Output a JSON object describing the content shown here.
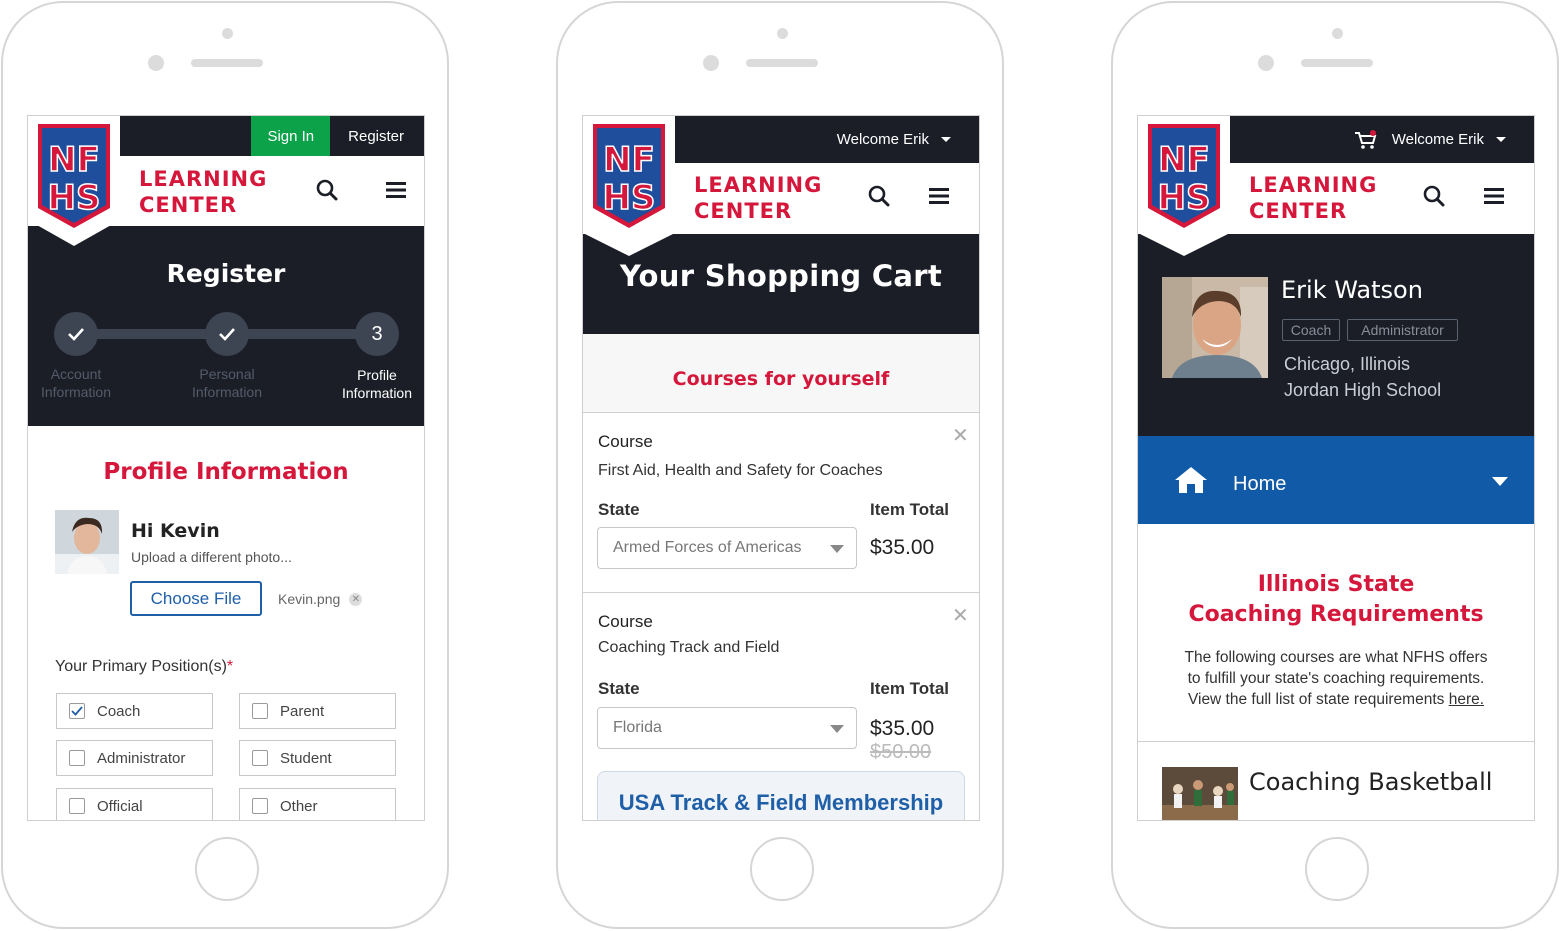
{
  "brand": {
    "logo_letters_top": "NF",
    "logo_letters_bottom": "HS",
    "line1": "LEARNING",
    "line2": "CENTER",
    "red": "#d4173a",
    "navy": "#1b1e27",
    "blue": "#105aa8",
    "green": "#0ba24a"
  },
  "screen1": {
    "signin_label": "Sign In",
    "register_label": "Register",
    "page_title": "Register",
    "steps": [
      {
        "label_line1": "Account",
        "label_line2": "Information",
        "state": "done"
      },
      {
        "label_line1": "Personal",
        "label_line2": "Information",
        "state": "done"
      },
      {
        "number": "3",
        "label_line1": "Profile",
        "label_line2": "Information",
        "state": "active"
      }
    ],
    "section_title": "Profile Information",
    "greeting": "Hi Kevin",
    "upload_text": "Upload a different photo...",
    "choose_file_label": "Choose File",
    "file_name": "Kevin.png",
    "positions_label": "Your Primary Position(s)",
    "required_mark": "*",
    "positions": [
      {
        "label": "Coach",
        "checked": true
      },
      {
        "label": "Parent",
        "checked": false
      },
      {
        "label": "Administrator",
        "checked": false
      },
      {
        "label": "Student",
        "checked": false
      },
      {
        "label": "Official",
        "checked": false
      },
      {
        "label": "Other",
        "checked": false
      }
    ]
  },
  "screen2": {
    "welcome": "Welcome Erik",
    "page_title": "Your Shopping Cart",
    "section_title": "Courses for yourself",
    "items": [
      {
        "course_label": "Course",
        "course_name": "First Aid, Health and Safety for Coaches",
        "state_label": "State",
        "state_value": "Armed Forces of Americas",
        "total_label": "Item Total",
        "price": "$35.00",
        "old_price": ""
      },
      {
        "course_label": "Course",
        "course_name": "Coaching Track and Field",
        "state_label": "State",
        "state_value": "Florida",
        "total_label": "Item Total",
        "price": "$35.00",
        "old_price": "$50.00"
      }
    ],
    "membership_label": "USA Track & Field Membership"
  },
  "screen3": {
    "welcome": "Welcome Erik",
    "user_name": "Erik Watson",
    "tags": [
      "Coach",
      "Administrator"
    ],
    "location": "Chicago, Illinois",
    "school": "Jordan High School",
    "nav_label": "Home",
    "req_title_line1": "Illinois State",
    "req_title_line2": "Coaching Requirements",
    "req_text_line1": "The following courses are what NFHS offers",
    "req_text_line2": "to fulfill your state's coaching requirements.",
    "req_text_line3": "View the full list of state requirements",
    "req_link": "here.",
    "course_title": "Coaching Basketball"
  }
}
